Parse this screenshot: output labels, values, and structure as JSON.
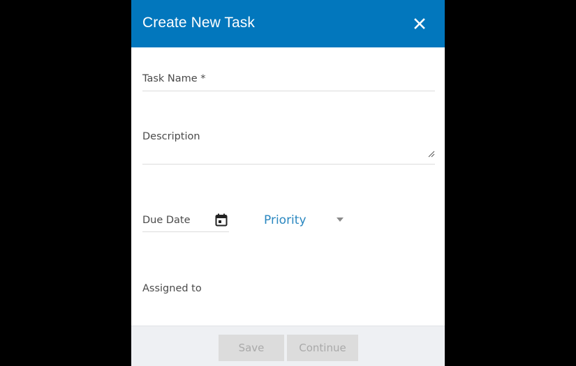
{
  "dialog": {
    "title": "Create New Task",
    "close_icon": "close-icon"
  },
  "form": {
    "task_name": {
      "label": "Task Name *",
      "value": ""
    },
    "description": {
      "label": "Description",
      "value": ""
    },
    "due_date": {
      "label": "Due Date",
      "icon": "calendar-icon",
      "value": ""
    },
    "priority": {
      "label": "Priority",
      "icon": "caret-down-icon"
    },
    "assigned_to": {
      "label": "Assigned to",
      "value": ""
    }
  },
  "footer": {
    "save_label": "Save",
    "continue_label": "Continue"
  },
  "colors": {
    "header": "#0277bd",
    "priority_text": "#2a87c0",
    "disabled_button": "#dcdcdc",
    "footer_bg": "#eef0f3"
  }
}
